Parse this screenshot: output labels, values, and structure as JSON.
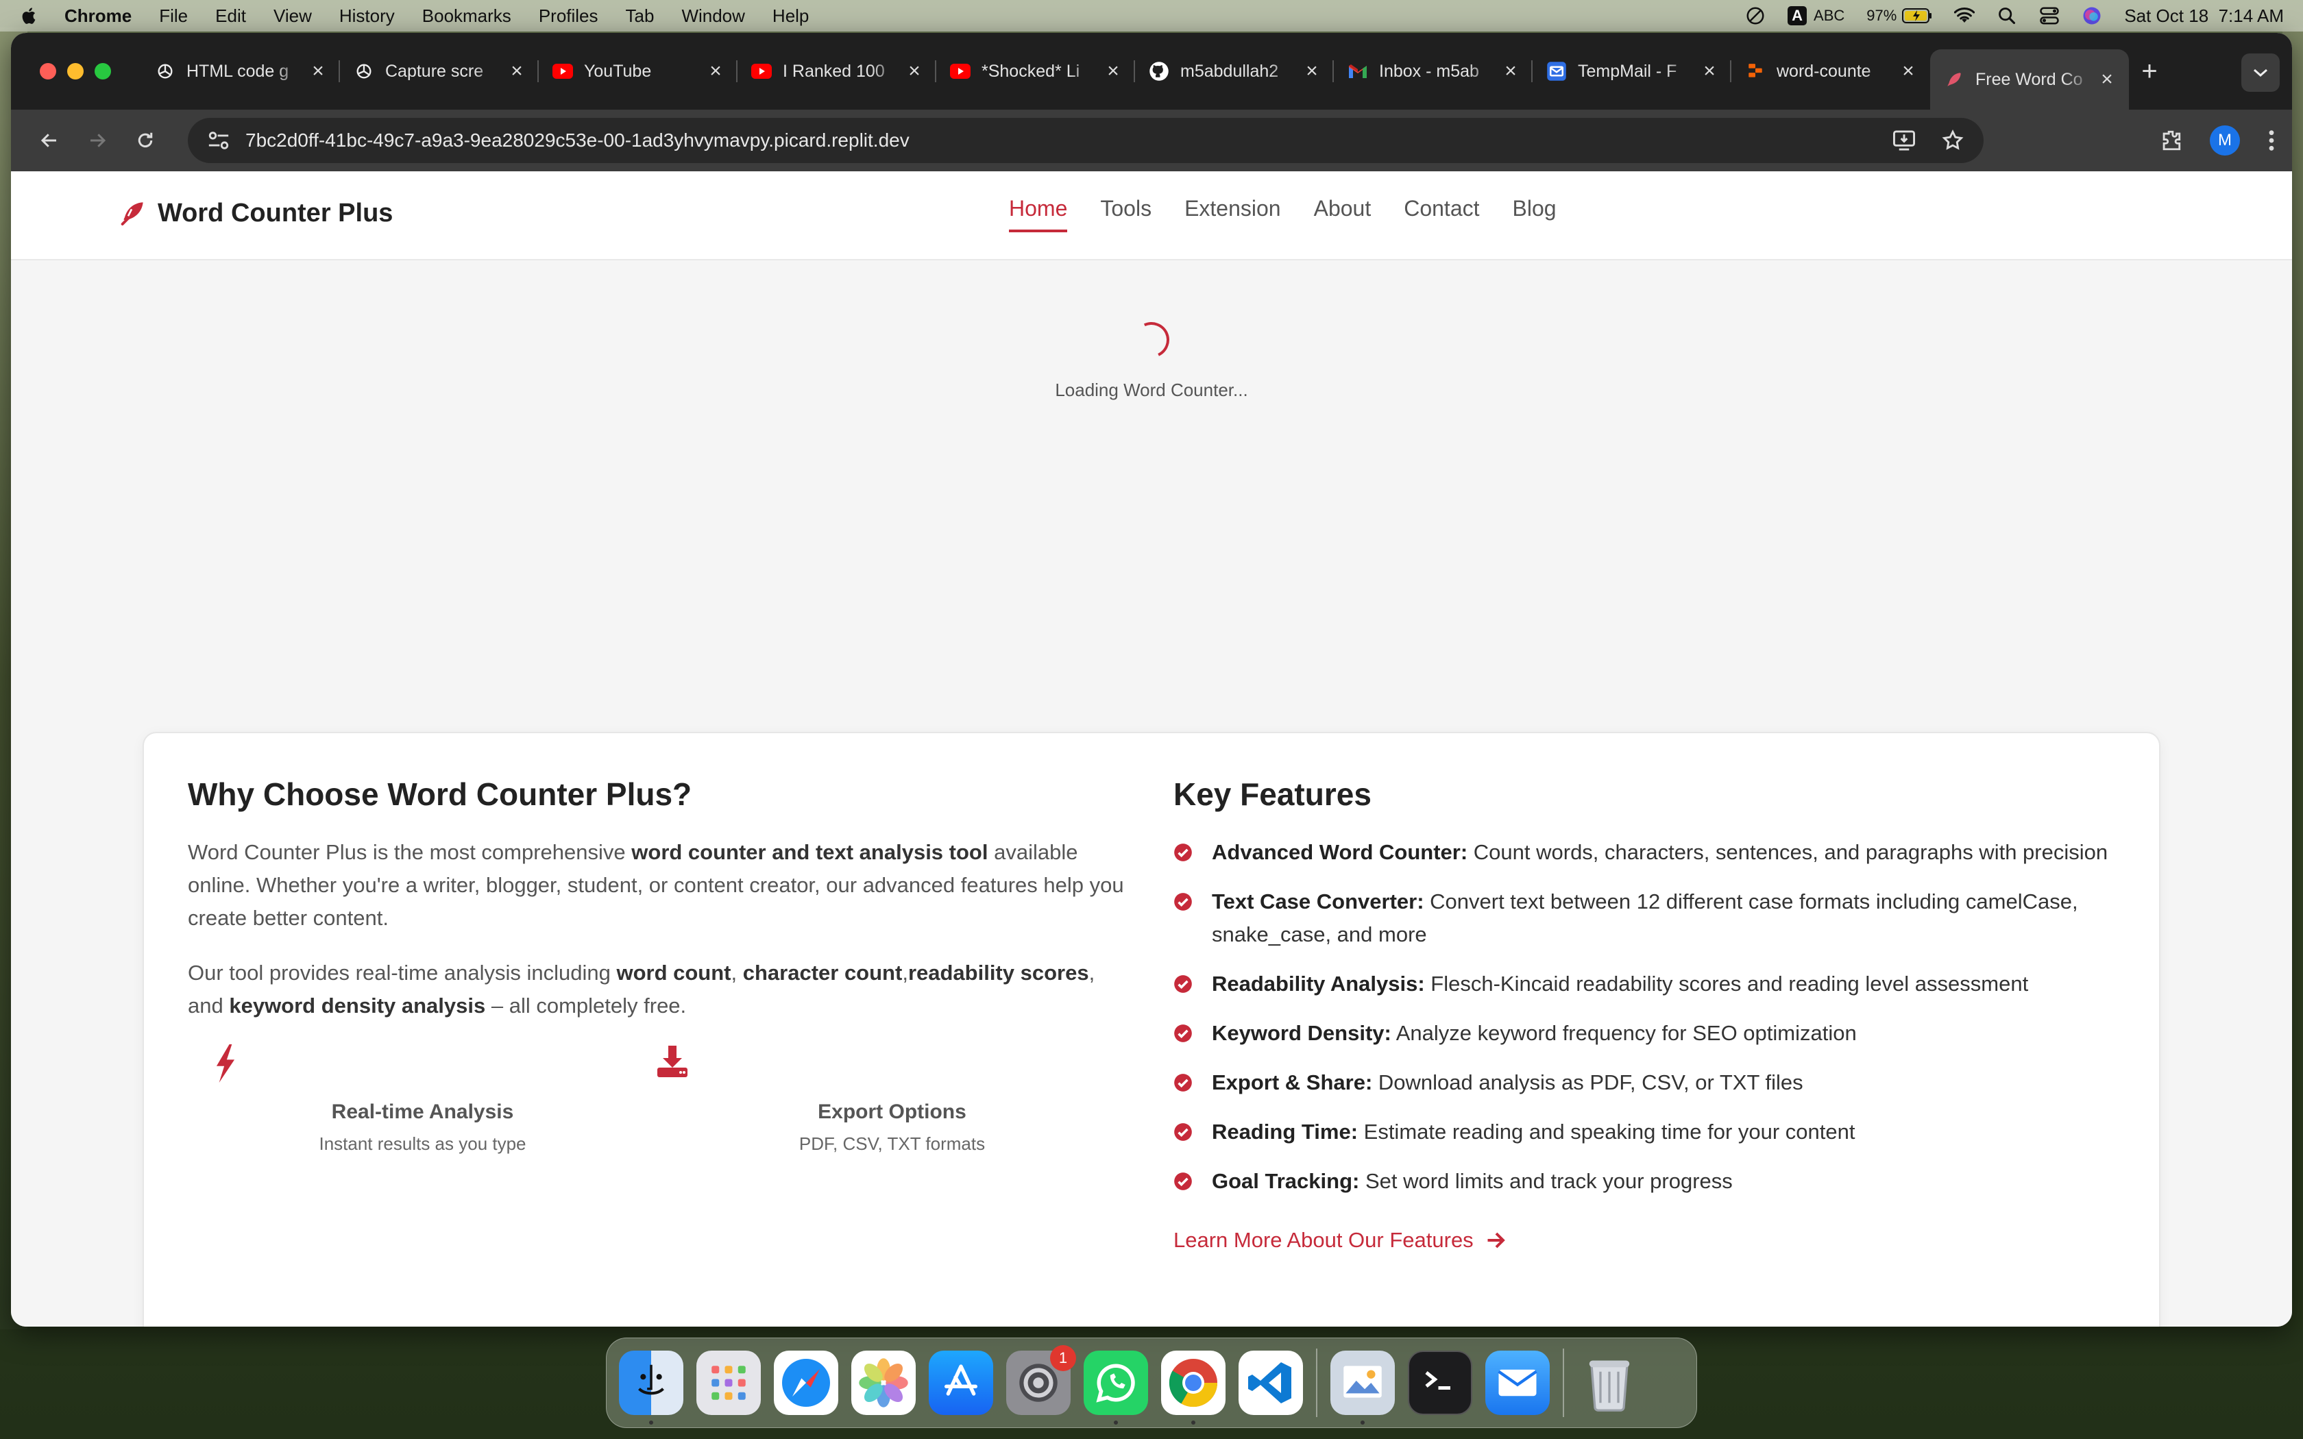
{
  "menubar": {
    "app": "Chrome",
    "items": [
      "File",
      "Edit",
      "View",
      "History",
      "Bookmarks",
      "Profiles",
      "Tab",
      "Window",
      "Help"
    ],
    "input_source": "A",
    "input_label": "ABC",
    "battery": "97%",
    "datetime": "Sat Oct 18  7:14 AM"
  },
  "browser": {
    "tabs": [
      {
        "title": "HTML code g",
        "icon": "chatgpt-icon"
      },
      {
        "title": "Capture scre",
        "icon": "chatgpt-icon"
      },
      {
        "title": "YouTube",
        "icon": "youtube-icon"
      },
      {
        "title": "I Ranked 100",
        "icon": "youtube-icon"
      },
      {
        "title": "*Shocked* Li",
        "icon": "youtube-icon"
      },
      {
        "title": "m5abdullah2",
        "icon": "github-icon"
      },
      {
        "title": "Inbox - m5ab",
        "icon": "gmail-icon"
      },
      {
        "title": "TempMail - F",
        "icon": "tempmail-icon"
      },
      {
        "title": "word-counte",
        "icon": "replit-icon"
      },
      {
        "title": "Free Word Co",
        "icon": "feather-pen-icon",
        "active": true
      }
    ],
    "url": "7bc2d0ff-41bc-49c7-a9a3-9ea28029c53e-00-1ad3yhvymavpy.picard.replit.dev",
    "profile_initial": "M"
  },
  "site": {
    "brand": "Word Counter Plus",
    "nav": [
      "Home",
      "Tools",
      "Extension",
      "About",
      "Contact",
      "Blog"
    ],
    "active_nav": "Home",
    "accent": "#c62a3a",
    "loading": "Loading Word Counter...",
    "why": {
      "title": "Why Choose Word Counter Plus?",
      "p1": [
        {
          "t": "Word Counter Plus is the most comprehensive "
        },
        {
          "t": "word counter and text analysis tool",
          "b": true
        },
        {
          "t": " available online. Whether you're a writer, blogger, student, or content creator, our advanced features help you create better content."
        }
      ],
      "p2": [
        {
          "t": "Our tool provides real-time analysis including "
        },
        {
          "t": "word count",
          "b": true
        },
        {
          "t": ", "
        },
        {
          "t": "character count",
          "b": true
        },
        {
          "t": ","
        },
        {
          "t": "readability scores",
          "b": true
        },
        {
          "t": ", and "
        },
        {
          "t": "keyword density analysis",
          "b": true
        },
        {
          "t": " – all completely free."
        }
      ],
      "features": [
        {
          "title": "Real-time Analysis",
          "desc": "Instant results as you type",
          "icon": "lightning-icon"
        },
        {
          "title": "Export Options",
          "desc": "PDF, CSV, TXT formats",
          "icon": "download-icon"
        }
      ]
    },
    "key": {
      "title": "Key Features",
      "items": [
        {
          "label": "Advanced Word Counter:",
          "text": " Count words, characters, sentences, and paragraphs with precision"
        },
        {
          "label": "Text Case Converter:",
          "text": " Convert text between 12 different case formats including camelCase, snake_case, and more"
        },
        {
          "label": "Readability Analysis:",
          "text": " Flesch-Kincaid readability scores and reading level assessment"
        },
        {
          "label": "Keyword Density:",
          "text": " Analyze keyword frequency for SEO optimization"
        },
        {
          "label": "Export & Share:",
          "text": " Download analysis as PDF, CSV, or TXT files"
        },
        {
          "label": "Reading Time:",
          "text": " Estimate reading and speaking time for your content"
        },
        {
          "label": "Goal Tracking:",
          "text": " Set word limits and track your progress"
        }
      ],
      "learn_more": "Learn More About Our Features"
    }
  },
  "dock": {
    "apps": [
      "Finder",
      "Launchpad",
      "Safari",
      "Photos",
      "App Store",
      "System Settings",
      "WhatsApp",
      "Google Chrome",
      "Visual Studio Code",
      "Preview",
      "Terminal",
      "Mail",
      "Trash"
    ],
    "settings_badge": "1"
  }
}
